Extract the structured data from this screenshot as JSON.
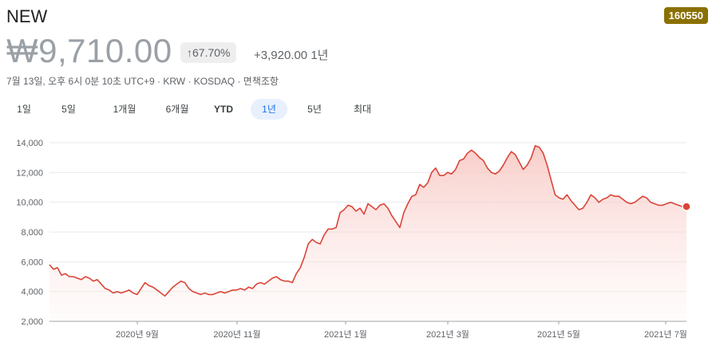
{
  "header": {
    "name": "NEW",
    "ticker": "160550",
    "price": "₩9,710.00",
    "change_pct": "↑67.70%",
    "change_abs": "+3,920.00 1년",
    "meta": "7월 13일, 오후 6시 0분 10초 UTC+9 · KRW · KOSDAQ · 면책조항"
  },
  "tabs": [
    {
      "label": "1일"
    },
    {
      "label": "5일"
    },
    {
      "label": "1개월"
    },
    {
      "label": "6개월"
    },
    {
      "label": "YTD"
    },
    {
      "label": "1년",
      "active": true
    },
    {
      "label": "5년"
    },
    {
      "label": "최대"
    }
  ],
  "colors": {
    "line": "#db4437",
    "fill_top": "#f7c4bf",
    "grid": "#e8eaed"
  },
  "chart_data": {
    "type": "area",
    "y_ticks": [
      2000,
      4000,
      6000,
      8000,
      10000,
      12000,
      14000
    ],
    "y_tick_labels": [
      "2,000",
      "4,000",
      "6,000",
      "8,000",
      "10,000",
      "12,000",
      "14,000"
    ],
    "ylim": [
      2000,
      14000
    ],
    "x_ticks": [
      "2020년 9월",
      "2020년 11월",
      "2021년 1월",
      "2021년 3월",
      "2021년 5월",
      "2021년 7월"
    ],
    "series": [
      {
        "values": [
          5800,
          5500,
          5600,
          5100,
          5200,
          5000,
          5000,
          4900,
          4800,
          5000,
          4900,
          4700,
          4800,
          4500,
          4200,
          4100,
          3900,
          4000,
          3900,
          4000,
          4100,
          3900,
          3800,
          4200,
          4600,
          4400,
          4300,
          4100,
          3900,
          3700,
          4000,
          4300,
          4500,
          4700,
          4600,
          4200,
          4000,
          3900,
          3800,
          3900,
          3800,
          3800,
          3900,
          4000,
          3900,
          4000,
          4100,
          4100,
          4200,
          4100,
          4300,
          4200,
          4500,
          4600,
          4500,
          4700,
          4900,
          5000,
          4800,
          4700,
          4700,
          4600,
          5200,
          5600,
          6300,
          7200,
          7500,
          7300,
          7200,
          7800,
          8200,
          8200,
          8300,
          9300,
          9500,
          9800,
          9700,
          9400,
          9600,
          9200,
          9900,
          9700,
          9500,
          9800,
          9900,
          9600,
          9100,
          8700,
          8300,
          9300,
          9900,
          10400,
          10500,
          11200,
          11000,
          11300,
          12000,
          12300,
          11800,
          11800,
          12000,
          11900,
          12200,
          12800,
          12900,
          13300,
          13500,
          13300,
          13000,
          12800,
          12300,
          12000,
          11900,
          12100,
          12500,
          13000,
          13400,
          13200,
          12700,
          12200,
          12500,
          13000,
          13800,
          13700,
          13300,
          12500,
          11500,
          10500,
          10300,
          10200,
          10500,
          10100,
          9800,
          9500,
          9600,
          10000,
          10500,
          10300,
          10000,
          10200,
          10300,
          10500,
          10400,
          10400,
          10200,
          10000,
          9900,
          10000,
          10200,
          10400,
          10300,
          10000,
          9900,
          9800,
          9800,
          9900,
          10000,
          9900,
          9800,
          9700,
          9710
        ],
        "last_value": 9710
      }
    ]
  }
}
